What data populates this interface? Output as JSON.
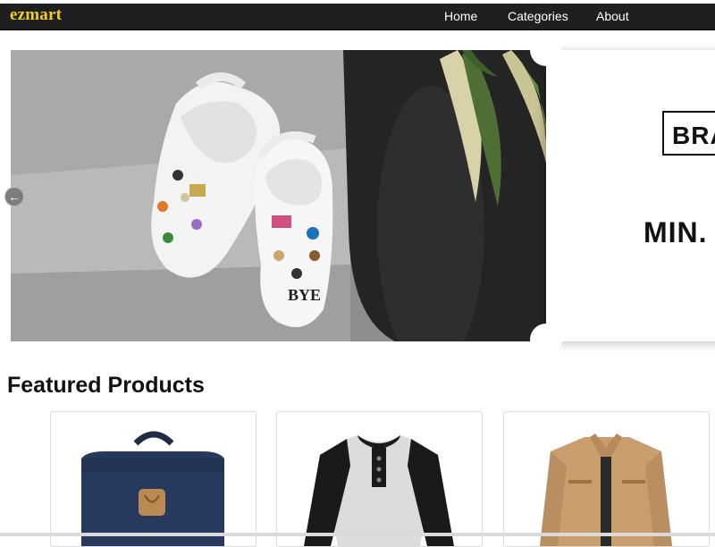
{
  "navbar": {
    "logo": "ezmart",
    "links": [
      {
        "label": "Home"
      },
      {
        "label": "Categories"
      },
      {
        "label": "About"
      }
    ]
  },
  "hero": {
    "slide_image": "white-clogs-with-charms-photo",
    "coupon": {
      "brand_label": "BRA",
      "discount_label": "MIN."
    },
    "prev_icon": "arrow-left-icon"
  },
  "featured": {
    "title": "Featured Products",
    "products": [
      {
        "image": "navy-backpack"
      },
      {
        "image": "raglan-henley-shirt"
      },
      {
        "image": "tan-jacket"
      }
    ]
  },
  "colors": {
    "navbar_bg": "#1f1f1f",
    "logo": "#f1d21b",
    "nav_text": "#ffffff"
  }
}
